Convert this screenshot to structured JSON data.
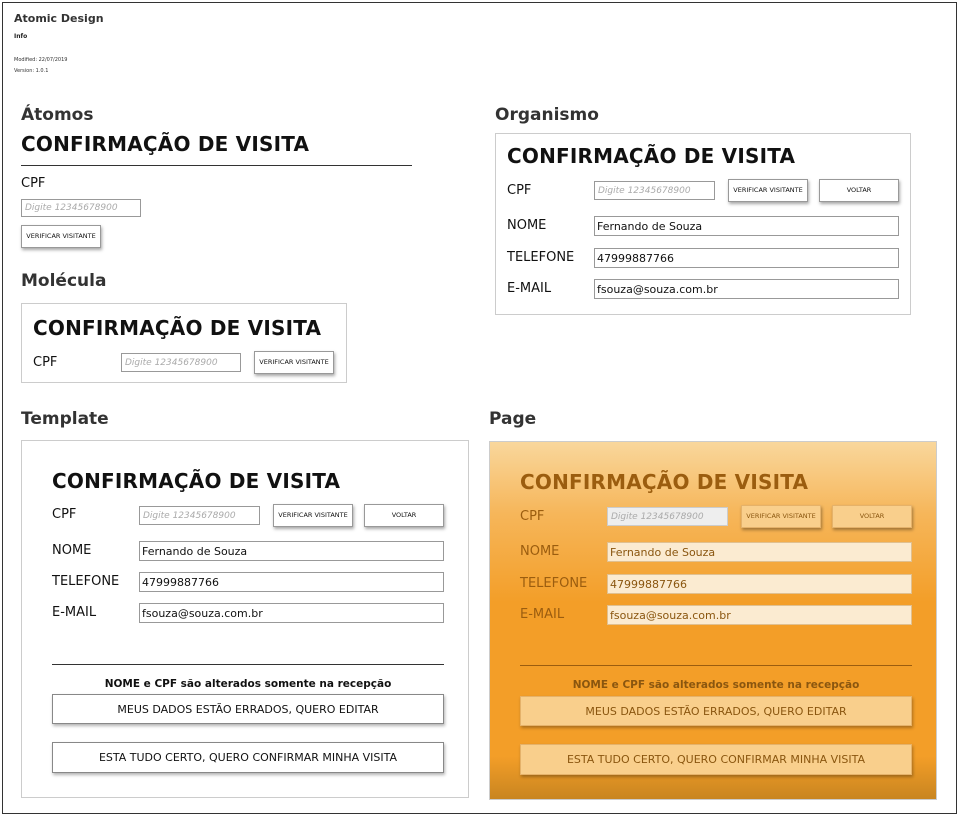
{
  "doc": {
    "title": "Atomic Design",
    "info": "Info",
    "modified": "Modified: 22/07/2019",
    "version": "Version: 1.0.1"
  },
  "sections": {
    "atomos": "Átomos",
    "molecula": "Molécula",
    "organismo": "Organismo",
    "template": "Template",
    "page": "Page"
  },
  "form": {
    "heading": "CONFIRMAÇÃO DE VISITA",
    "cpf_label": "CPF",
    "cpf_placeholder": "Digite 12345678900",
    "verify_button": "VERIFICAR VISITANTE",
    "back_button": "VOLTAR",
    "name_label": "NOME",
    "name_value": "Fernando de Souza",
    "phone_label": "TELEFONE",
    "phone_value": "47999887766",
    "email_label": "E-MAIL",
    "email_value": "fsouza@souza.com.br",
    "note": "NOME e CPF são alterados somente na recepção",
    "edit_button": "MEUS DADOS ESTÃO ERRADOS, QUERO EDITAR",
    "confirm_button": "ESTA TUDO CERTO, QUERO CONFIRMAR MINHA VISITA"
  },
  "colors": {
    "page_accent": "#f39e28",
    "page_text": "#9b5d0f"
  }
}
